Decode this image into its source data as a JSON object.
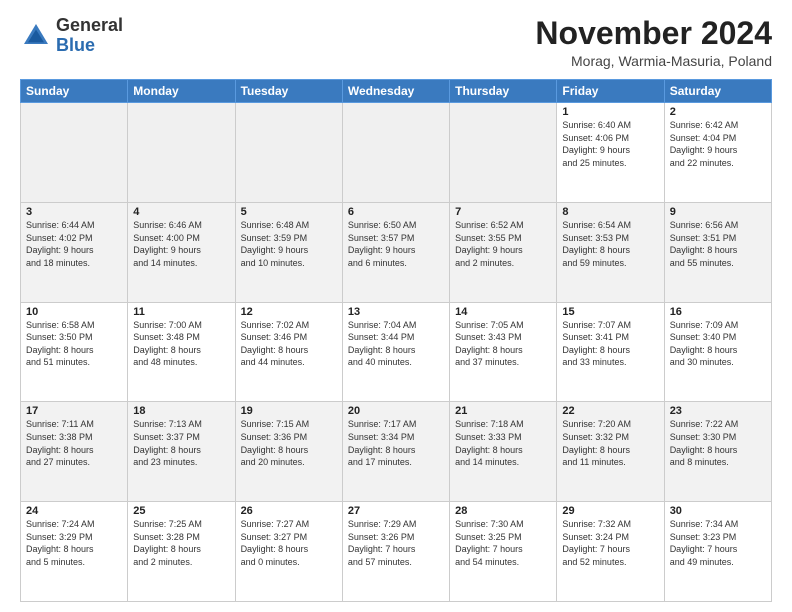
{
  "header": {
    "logo": {
      "general": "General",
      "blue": "Blue"
    },
    "title": "November 2024",
    "location": "Morag, Warmia-Masuria, Poland"
  },
  "weekdays": [
    "Sunday",
    "Monday",
    "Tuesday",
    "Wednesday",
    "Thursday",
    "Friday",
    "Saturday"
  ],
  "weeks": [
    [
      {
        "day": null,
        "info": ""
      },
      {
        "day": null,
        "info": ""
      },
      {
        "day": null,
        "info": ""
      },
      {
        "day": null,
        "info": ""
      },
      {
        "day": null,
        "info": ""
      },
      {
        "day": "1",
        "info": "Sunrise: 6:40 AM\nSunset: 4:06 PM\nDaylight: 9 hours\nand 25 minutes."
      },
      {
        "day": "2",
        "info": "Sunrise: 6:42 AM\nSunset: 4:04 PM\nDaylight: 9 hours\nand 22 minutes."
      }
    ],
    [
      {
        "day": "3",
        "info": "Sunrise: 6:44 AM\nSunset: 4:02 PM\nDaylight: 9 hours\nand 18 minutes."
      },
      {
        "day": "4",
        "info": "Sunrise: 6:46 AM\nSunset: 4:00 PM\nDaylight: 9 hours\nand 14 minutes."
      },
      {
        "day": "5",
        "info": "Sunrise: 6:48 AM\nSunset: 3:59 PM\nDaylight: 9 hours\nand 10 minutes."
      },
      {
        "day": "6",
        "info": "Sunrise: 6:50 AM\nSunset: 3:57 PM\nDaylight: 9 hours\nand 6 minutes."
      },
      {
        "day": "7",
        "info": "Sunrise: 6:52 AM\nSunset: 3:55 PM\nDaylight: 9 hours\nand 2 minutes."
      },
      {
        "day": "8",
        "info": "Sunrise: 6:54 AM\nSunset: 3:53 PM\nDaylight: 8 hours\nand 59 minutes."
      },
      {
        "day": "9",
        "info": "Sunrise: 6:56 AM\nSunset: 3:51 PM\nDaylight: 8 hours\nand 55 minutes."
      }
    ],
    [
      {
        "day": "10",
        "info": "Sunrise: 6:58 AM\nSunset: 3:50 PM\nDaylight: 8 hours\nand 51 minutes."
      },
      {
        "day": "11",
        "info": "Sunrise: 7:00 AM\nSunset: 3:48 PM\nDaylight: 8 hours\nand 48 minutes."
      },
      {
        "day": "12",
        "info": "Sunrise: 7:02 AM\nSunset: 3:46 PM\nDaylight: 8 hours\nand 44 minutes."
      },
      {
        "day": "13",
        "info": "Sunrise: 7:04 AM\nSunset: 3:44 PM\nDaylight: 8 hours\nand 40 minutes."
      },
      {
        "day": "14",
        "info": "Sunrise: 7:05 AM\nSunset: 3:43 PM\nDaylight: 8 hours\nand 37 minutes."
      },
      {
        "day": "15",
        "info": "Sunrise: 7:07 AM\nSunset: 3:41 PM\nDaylight: 8 hours\nand 33 minutes."
      },
      {
        "day": "16",
        "info": "Sunrise: 7:09 AM\nSunset: 3:40 PM\nDaylight: 8 hours\nand 30 minutes."
      }
    ],
    [
      {
        "day": "17",
        "info": "Sunrise: 7:11 AM\nSunset: 3:38 PM\nDaylight: 8 hours\nand 27 minutes."
      },
      {
        "day": "18",
        "info": "Sunrise: 7:13 AM\nSunset: 3:37 PM\nDaylight: 8 hours\nand 23 minutes."
      },
      {
        "day": "19",
        "info": "Sunrise: 7:15 AM\nSunset: 3:36 PM\nDaylight: 8 hours\nand 20 minutes."
      },
      {
        "day": "20",
        "info": "Sunrise: 7:17 AM\nSunset: 3:34 PM\nDaylight: 8 hours\nand 17 minutes."
      },
      {
        "day": "21",
        "info": "Sunrise: 7:18 AM\nSunset: 3:33 PM\nDaylight: 8 hours\nand 14 minutes."
      },
      {
        "day": "22",
        "info": "Sunrise: 7:20 AM\nSunset: 3:32 PM\nDaylight: 8 hours\nand 11 minutes."
      },
      {
        "day": "23",
        "info": "Sunrise: 7:22 AM\nSunset: 3:30 PM\nDaylight: 8 hours\nand 8 minutes."
      }
    ],
    [
      {
        "day": "24",
        "info": "Sunrise: 7:24 AM\nSunset: 3:29 PM\nDaylight: 8 hours\nand 5 minutes."
      },
      {
        "day": "25",
        "info": "Sunrise: 7:25 AM\nSunset: 3:28 PM\nDaylight: 8 hours\nand 2 minutes."
      },
      {
        "day": "26",
        "info": "Sunrise: 7:27 AM\nSunset: 3:27 PM\nDaylight: 8 hours\nand 0 minutes."
      },
      {
        "day": "27",
        "info": "Sunrise: 7:29 AM\nSunset: 3:26 PM\nDaylight: 7 hours\nand 57 minutes."
      },
      {
        "day": "28",
        "info": "Sunrise: 7:30 AM\nSunset: 3:25 PM\nDaylight: 7 hours\nand 54 minutes."
      },
      {
        "day": "29",
        "info": "Sunrise: 7:32 AM\nSunset: 3:24 PM\nDaylight: 7 hours\nand 52 minutes."
      },
      {
        "day": "30",
        "info": "Sunrise: 7:34 AM\nSunset: 3:23 PM\nDaylight: 7 hours\nand 49 minutes."
      }
    ]
  ]
}
